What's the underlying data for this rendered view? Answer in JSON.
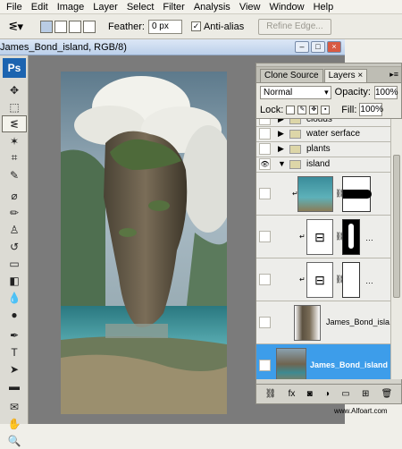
{
  "menu": [
    "File",
    "Edit",
    "Image",
    "Layer",
    "Select",
    "Filter",
    "Analysis",
    "View",
    "Window",
    "Help"
  ],
  "options": {
    "feather_label": "Feather:",
    "feather_value": "0 px",
    "antialias_label": "Anti-alias",
    "antialias_checked": true,
    "refine_edge": "Refine Edge..."
  },
  "document": {
    "title": "James_Bond_island, RGB/8)"
  },
  "tools": {
    "app_logo": "Ps"
  },
  "layers_panel": {
    "tabs": [
      "Clone Source",
      "Layers"
    ],
    "blend_mode": "Normal",
    "opacity_label": "Opacity:",
    "opacity_value": "100%",
    "lock_label": "Lock:",
    "fill_label": "Fill:",
    "fill_value": "100%",
    "groups": [
      "clouds",
      "water serface",
      "plants",
      "island"
    ],
    "layer_name_1": "James_Bond_isla...",
    "layer_name_2": "James_Bond_island",
    "close": "×"
  },
  "watermark": "www.Alfoart.com",
  "colors": {
    "selection": "#3d9dea",
    "ps_blue": "#1c64b0"
  }
}
